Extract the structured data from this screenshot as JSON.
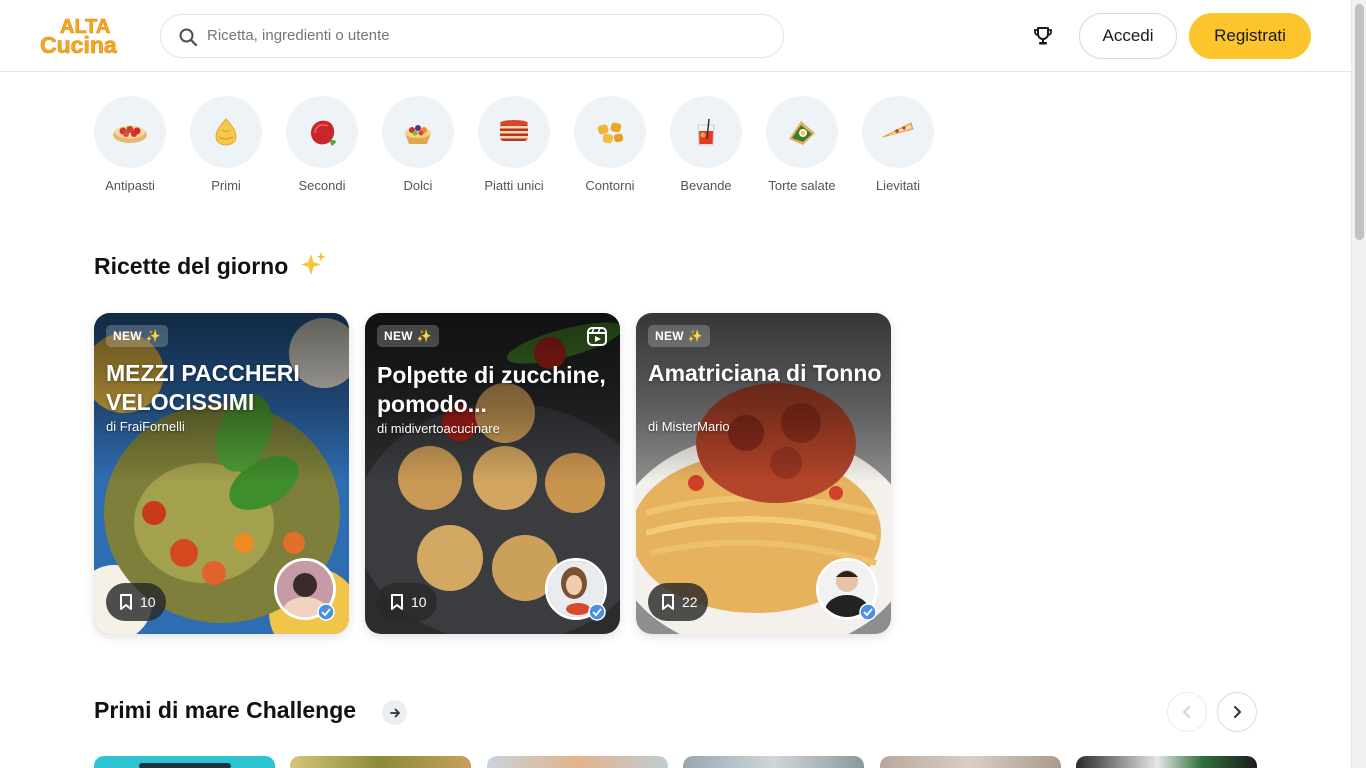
{
  "header": {
    "logo_line1": "ALTA",
    "logo_line2": "Cucina",
    "search_placeholder": "Ricetta, ingredienti o utente",
    "login_label": "Accedi",
    "register_label": "Registrati",
    "brand_color": "#fcc52b"
  },
  "categories": [
    {
      "label": "Antipasti",
      "icon": "bruschetta-icon"
    },
    {
      "label": "Primi",
      "icon": "dumpling-icon"
    },
    {
      "label": "Secondi",
      "icon": "meat-icon"
    },
    {
      "label": "Dolci",
      "icon": "fruit-tart-icon"
    },
    {
      "label": "Piatti unici",
      "icon": "lasagna-icon"
    },
    {
      "label": "Contorni",
      "icon": "potatoes-icon"
    },
    {
      "label": "Bevande",
      "icon": "cocktail-icon"
    },
    {
      "label": "Torte salate",
      "icon": "quiche-icon"
    },
    {
      "label": "Lievitati",
      "icon": "pizza-slice-icon"
    }
  ],
  "daily": {
    "title": "Ricette del giorno",
    "cards": [
      {
        "badge": "NEW",
        "title": "MEZZI PACCHERI VELOCISSIMI",
        "author": "di FraiFornelli",
        "saves": "10"
      },
      {
        "badge": "NEW",
        "title": "Polpette di zucchine, pomodo...",
        "author": "di midivertoacucinare",
        "saves": "10",
        "has_video": true
      },
      {
        "badge": "NEW",
        "title": "Amatriciana di Tonno",
        "author": "di MisterMario",
        "saves": "22"
      }
    ]
  },
  "challenge": {
    "title": "Primi di mare Challenge"
  }
}
